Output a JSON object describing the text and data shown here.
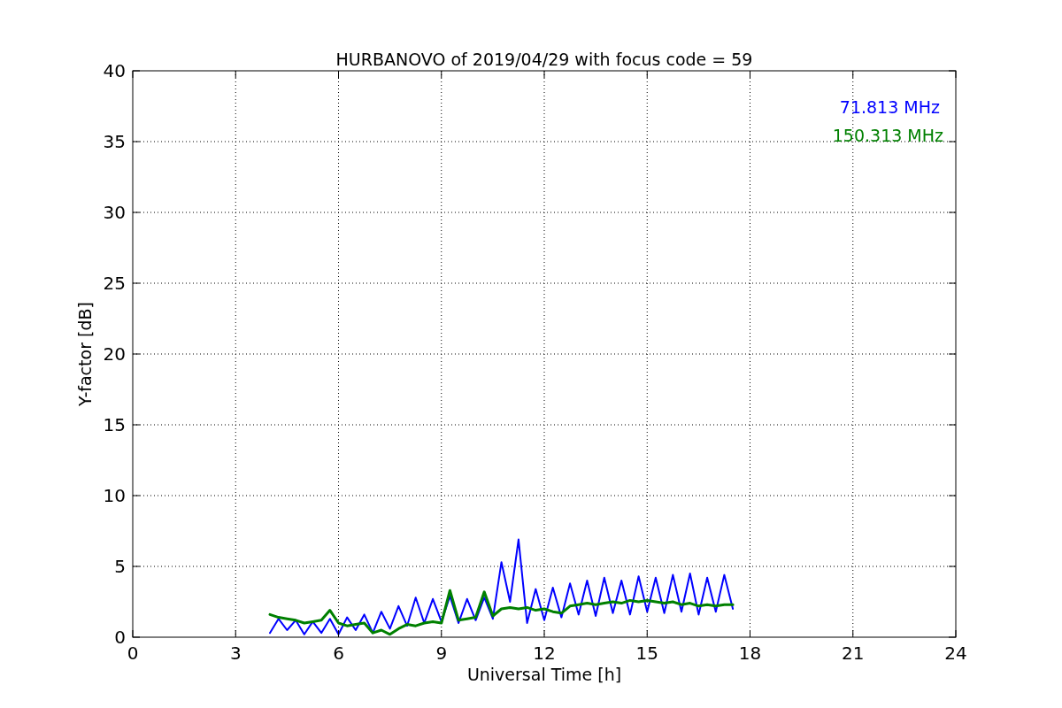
{
  "chart_data": {
    "type": "line",
    "title": "HURBANOVO of 2019/04/29 with focus code = 59",
    "xlabel": "Universal Time [h]",
    "ylabel": "Y-factor [dB]",
    "x": [
      4,
      4.25,
      4.5,
      4.75,
      5,
      5.25,
      5.5,
      5.75,
      6,
      6.25,
      6.5,
      6.75,
      7,
      7.25,
      7.5,
      7.75,
      8,
      8.25,
      8.5,
      8.75,
      9,
      9.25,
      9.5,
      9.75,
      10,
      10.25,
      10.5,
      10.75,
      11,
      11.25,
      11.5,
      11.75,
      12,
      12.25,
      12.5,
      12.75,
      13,
      13.25,
      13.5,
      13.75,
      14,
      14.25,
      14.5,
      14.75,
      15,
      15.25,
      15.5,
      15.75,
      16,
      16.25,
      16.5,
      16.75,
      17,
      17.25,
      17.5
    ],
    "series": [
      {
        "name": "71.813 MHz",
        "color": "#0000ff",
        "values": [
          0.3,
          1.3,
          0.5,
          1.2,
          0.2,
          1.1,
          0.3,
          1.3,
          0.2,
          1.4,
          0.5,
          1.6,
          0.3,
          1.8,
          0.6,
          2.2,
          0.8,
          2.8,
          1.0,
          2.7,
          1.1,
          2.9,
          1.0,
          2.7,
          1.2,
          2.8,
          1.3,
          5.3,
          2.5,
          6.9,
          1.0,
          3.4,
          1.2,
          3.5,
          1.4,
          3.8,
          1.6,
          4.0,
          1.5,
          4.2,
          1.7,
          4.0,
          1.6,
          4.3,
          1.8,
          4.2,
          1.7,
          4.4,
          1.8,
          4.5,
          1.6,
          4.2,
          1.8,
          4.4,
          2.0
        ]
      },
      {
        "name": "150.313 MHz",
        "color": "#008000",
        "values": [
          1.6,
          1.4,
          1.3,
          1.2,
          1.0,
          1.1,
          1.2,
          1.9,
          1.0,
          0.8,
          0.9,
          1.0,
          0.3,
          0.5,
          0.2,
          0.6,
          0.9,
          0.8,
          1.0,
          1.1,
          1.0,
          3.3,
          1.2,
          1.3,
          1.4,
          3.2,
          1.5,
          2.0,
          2.1,
          2.0,
          2.1,
          1.9,
          2.0,
          1.8,
          1.7,
          2.2,
          2.3,
          2.4,
          2.3,
          2.4,
          2.5,
          2.4,
          2.6,
          2.5,
          2.6,
          2.5,
          2.4,
          2.5,
          2.3,
          2.4,
          2.2,
          2.3,
          2.2,
          2.3,
          2.3
        ]
      }
    ],
    "xlim": [
      0,
      24
    ],
    "ylim": [
      0,
      40
    ],
    "xticks": [
      0,
      3,
      6,
      9,
      12,
      15,
      18,
      21,
      24
    ],
    "yticks": [
      0,
      5,
      10,
      15,
      20,
      25,
      30,
      35,
      40
    ],
    "grid": true
  }
}
